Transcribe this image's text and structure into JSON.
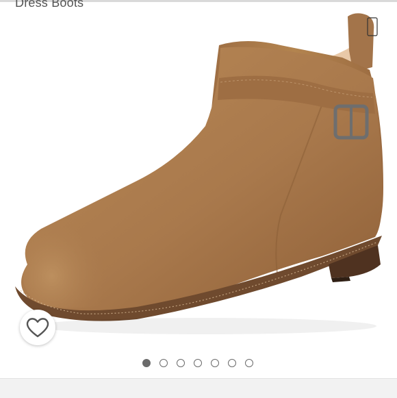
{
  "product": {
    "title": "Dress Boots",
    "image_icon": "ankle-boot-image"
  },
  "wishlist": {
    "icon": "heart-outline-icon",
    "color": "#555555"
  },
  "carousel": {
    "total": 7,
    "active_index": 0,
    "active_color": "#6b6b6b"
  },
  "colors": {
    "suede": "#a9794c",
    "suede_dark": "#8a5e37",
    "sole": "#5b3a24",
    "buckle": "#6e6e6e"
  }
}
